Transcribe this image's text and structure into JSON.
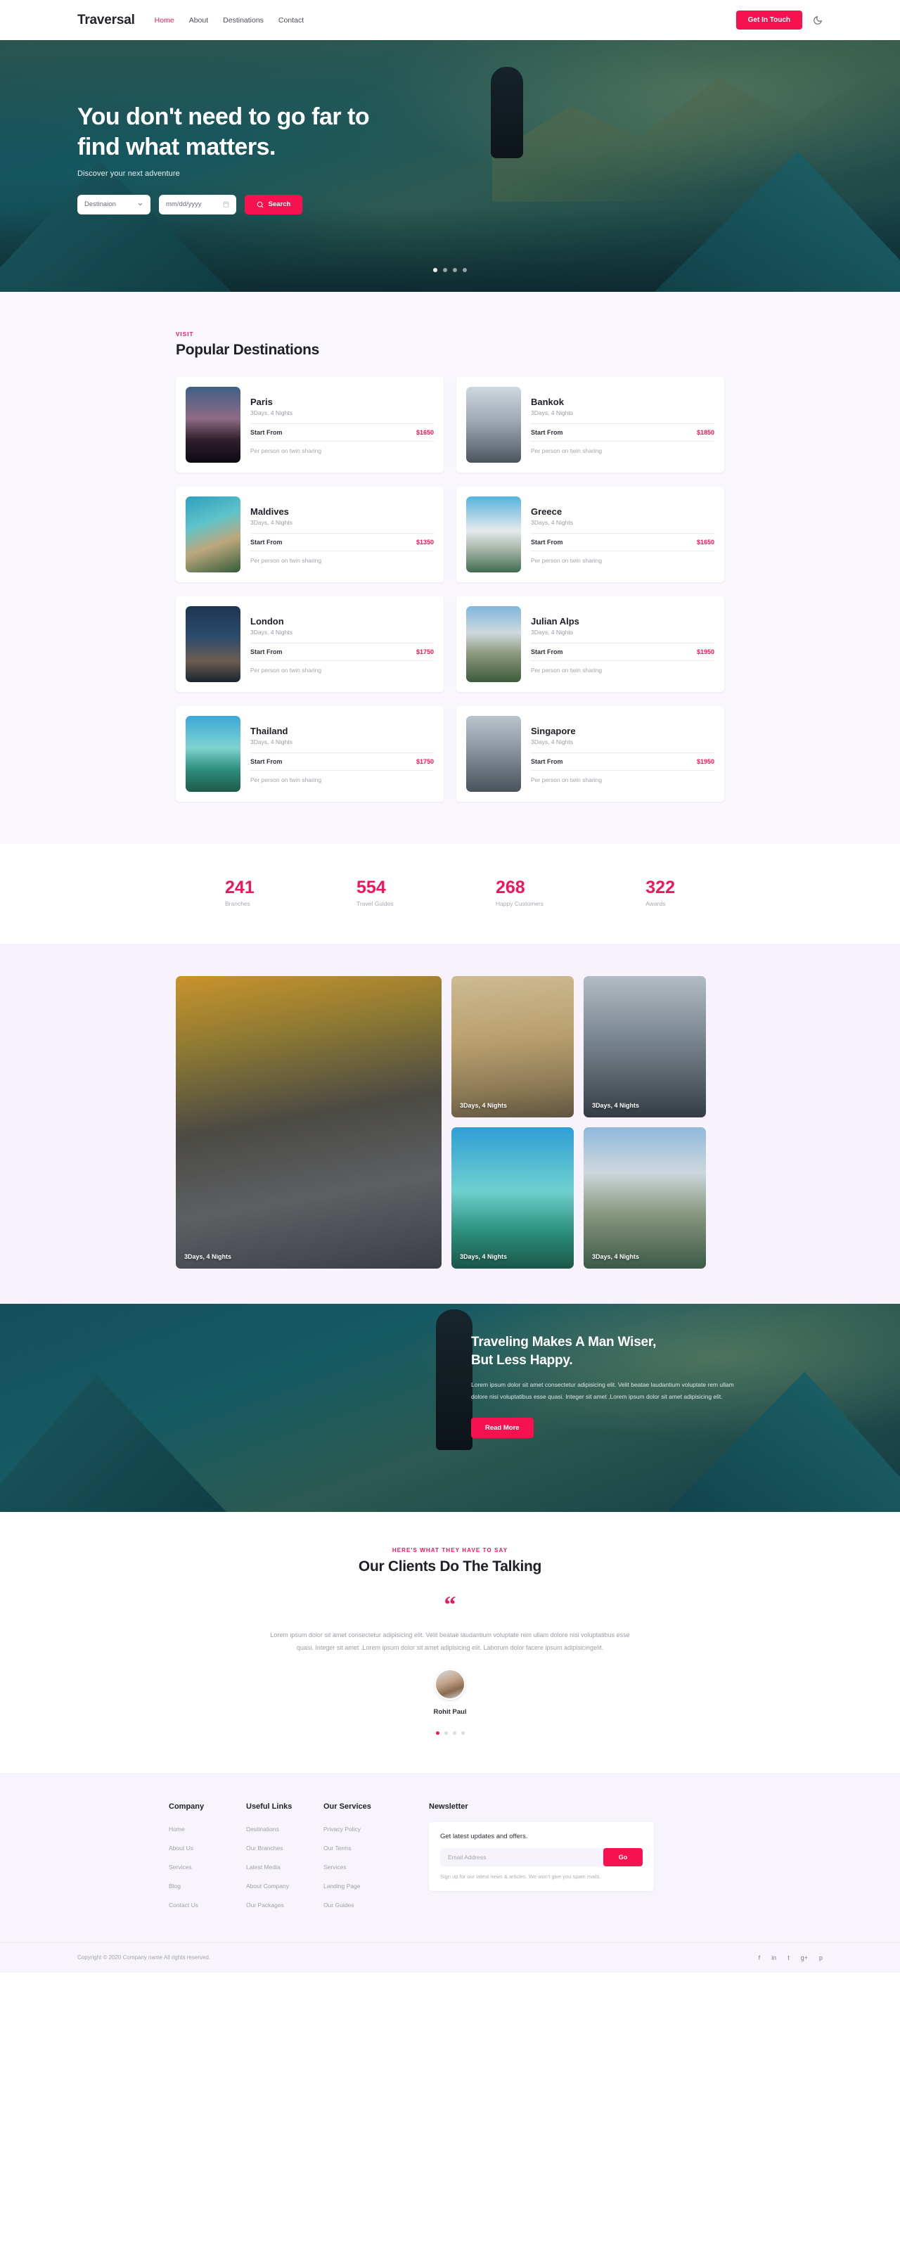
{
  "header": {
    "logo": "Traversal",
    "nav": [
      {
        "label": "Home",
        "active": true
      },
      {
        "label": "About",
        "active": false
      },
      {
        "label": "Destinations",
        "active": false
      },
      {
        "label": "Contact",
        "active": false
      }
    ],
    "cta_label": "Get In Touch",
    "theme_toggle_icon": "moon-icon",
    "accent_color": "#f5124f"
  },
  "hero": {
    "title_line1": "You don't need to go far to",
    "title_line2": "find what matters.",
    "subtitle": "Discover your next adventure",
    "destination_value": "Destinaion",
    "date_placeholder": "mm/dd/yyyy",
    "search_label": "Search",
    "slider_dots": 4,
    "slider_active_index": 0
  },
  "destinations": {
    "eyebrow": "VISIT",
    "title": "Popular Destinations",
    "start_label": "Start From",
    "note": "Per person on twin sharing",
    "duration": "3Days, 4 Nights",
    "items": [
      {
        "name": "Paris",
        "duration": "3Days, 4 Nights",
        "price": "$1650",
        "img": "img-paris"
      },
      {
        "name": "Bankok",
        "duration": "3Days, 4 Nights",
        "price": "$1850",
        "img": "img-bankok"
      },
      {
        "name": "Maldives",
        "duration": "3Days, 4 Nights",
        "price": "$1350",
        "img": "img-maldives"
      },
      {
        "name": "Greece",
        "duration": "3Days, 4 Nights",
        "price": "$1650",
        "img": "img-greece"
      },
      {
        "name": "London",
        "duration": "3Days, 4 Nights",
        "price": "$1750",
        "img": "img-london"
      },
      {
        "name": "Julian Alps",
        "duration": "3Days, 4 Nights",
        "price": "$1950",
        "img": "img-alps"
      },
      {
        "name": "Thailand",
        "duration": "3Days, 4 Nights",
        "price": "$1750",
        "img": "img-thailand"
      },
      {
        "name": "Singapore",
        "duration": "3Days, 4 Nights",
        "price": "$1950",
        "img": "img-singapore"
      }
    ]
  },
  "stats": [
    {
      "value": "241",
      "label": "Branches"
    },
    {
      "value": "554",
      "label": "Travel Guides"
    },
    {
      "value": "268",
      "label": "Happy Customers"
    },
    {
      "value": "322",
      "label": "Awards"
    }
  ],
  "gallery": {
    "caption": "3Days, 4 Nights",
    "items": [
      {
        "caption": "3Days, 4 Nights",
        "art": "g-big"
      },
      {
        "caption": "3Days, 4 Nights",
        "art": "g-1"
      },
      {
        "caption": "3Days, 4 Nights",
        "art": "g-2"
      },
      {
        "caption": "3Days, 4 Nights",
        "art": "g-3"
      },
      {
        "caption": "3Days, 4 Nights",
        "art": "g-4"
      }
    ]
  },
  "cta": {
    "title_line1": "Traveling Makes A Man Wiser,",
    "title_line2": "But Less Happy.",
    "paragraph": "Lorem ipsum dolor sit amet consectetur adipisicing elit. Velit beatae laudantium voluptate rem ullam dolore nisi voluptatibus esse quasi. Integer sit amet .Lorem ipsum dolor sit amet adipisicing elit.",
    "button_label": "Read More"
  },
  "testimonial": {
    "eyebrow": "HERE'S WHAT THEY HAVE TO SAY",
    "title": "Our Clients Do The Talking",
    "quote_mark": "“",
    "text": "Lorem ipsum dolor sit amet consectetur adipisicing elit. Velit beatae laudantium voluptate rem ullam dolore nisi voluptatibus esse quasi. Integer sit amet .Lorem ipsum dolor sit amet adipisicing elit. Laborum dolor facere ipsum adipisicingelit.",
    "author": "Rohit Paul",
    "dots": 4,
    "active_dot": 0
  },
  "footer": {
    "columns": [
      {
        "title": "Company",
        "links": [
          "Home",
          "About Us",
          "Services",
          "Blog",
          "Contact Us"
        ]
      },
      {
        "title": "Useful Links",
        "links": [
          "Destinations",
          "Our Branches",
          "Latest Media",
          "About Company",
          "Our Packages"
        ]
      },
      {
        "title": "Our Services",
        "links": [
          "Privacy Policy",
          "Our Terms",
          "Services",
          "Landing Page",
          "Our Guides"
        ]
      }
    ],
    "newsletter": {
      "title": "Newsletter",
      "heading": "Get latest updates and offers.",
      "placeholder": "Email Address",
      "button_label": "Go",
      "note": "Sign up for our latest news & articles. We won't give you spam mails."
    },
    "copyright": "Copyright © 2020 Company name All rights reserved.",
    "socials": [
      "facebook-icon",
      "linkedin-icon",
      "twitter-icon",
      "google-plus-icon",
      "pinterest-icon"
    ],
    "social_glyphs": [
      "f",
      "in",
      "t",
      "g+",
      "p"
    ]
  }
}
